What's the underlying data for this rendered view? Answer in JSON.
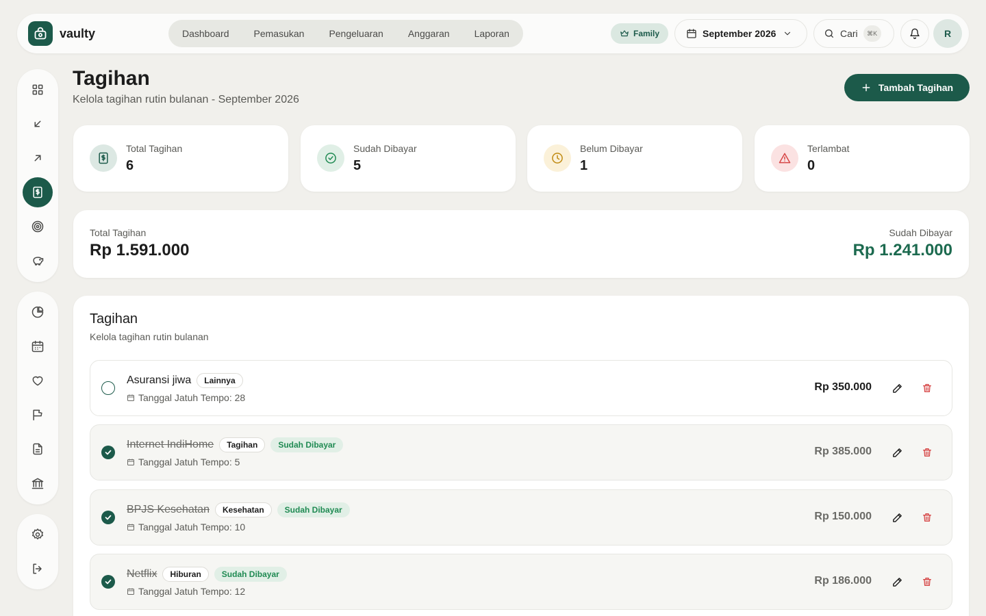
{
  "brand": {
    "name": "vaulty"
  },
  "nav": [
    {
      "label": "Dashboard"
    },
    {
      "label": "Pemasukan"
    },
    {
      "label": "Pengeluaran"
    },
    {
      "label": "Anggaran"
    },
    {
      "label": "Laporan"
    }
  ],
  "topbar": {
    "plan_badge": "Family",
    "month": "September 2026",
    "search_label": "Cari",
    "search_shortcut": "⌘K",
    "avatar_initial": "R"
  },
  "header": {
    "title": "Tagihan",
    "subtitle": "Kelola tagihan rutin bulanan - September 2026",
    "add_button": "Tambah Tagihan"
  },
  "stats": [
    {
      "label": "Total Tagihan",
      "value": "6"
    },
    {
      "label": "Sudah Dibayar",
      "value": "5"
    },
    {
      "label": "Belum Dibayar",
      "value": "1"
    },
    {
      "label": "Terlambat",
      "value": "0"
    }
  ],
  "summary": {
    "total_label": "Total Tagihan",
    "total_value": "Rp 1.591.000",
    "paid_label": "Sudah Dibayar",
    "paid_value": "Rp 1.241.000"
  },
  "bills_panel": {
    "title": "Tagihan",
    "subtitle": "Kelola tagihan rutin bulanan"
  },
  "bills": [
    {
      "name": "Asuransi jiwa",
      "category": "Lainnya",
      "status": "",
      "due": "Tanggal Jatuh Tempo: 28",
      "amount": "Rp 350.000",
      "paid": false
    },
    {
      "name": "Internet IndiHome",
      "category": "Tagihan",
      "status": "Sudah Dibayar",
      "due": "Tanggal Jatuh Tempo: 5",
      "amount": "Rp 385.000",
      "paid": true
    },
    {
      "name": "BPJS Kesehatan",
      "category": "Kesehatan",
      "status": "Sudah Dibayar",
      "due": "Tanggal Jatuh Tempo: 10",
      "amount": "Rp 150.000",
      "paid": true
    },
    {
      "name": "Netflix",
      "category": "Hiburan",
      "status": "Sudah Dibayar",
      "due": "Tanggal Jatuh Tempo: 12",
      "amount": "Rp 186.000",
      "paid": true
    }
  ],
  "colors": {
    "primary": "#1c5a4a",
    "paid_text": "#1f8a52",
    "danger": "#d64545",
    "background": "#f1f0ec"
  }
}
